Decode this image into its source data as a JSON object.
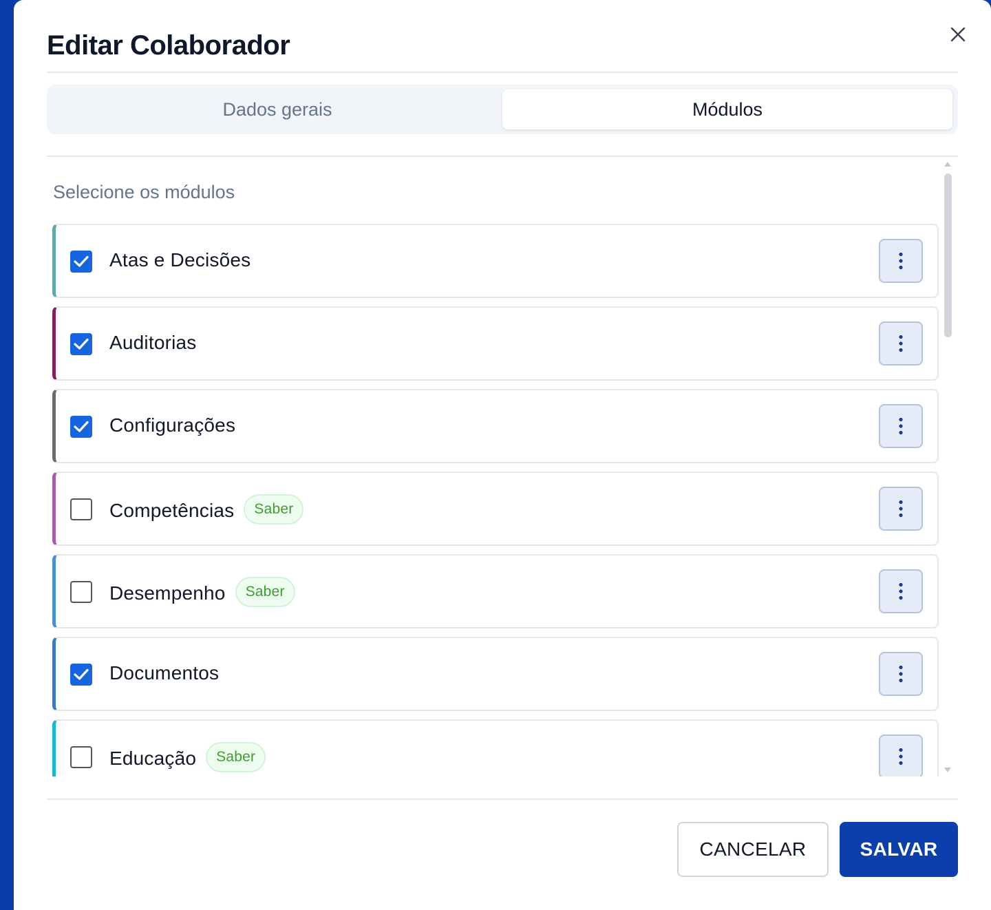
{
  "dialog": {
    "title": "Editar Colaborador",
    "close_icon": "close-icon"
  },
  "tabs": [
    {
      "label": "Dados gerais",
      "active": false
    },
    {
      "label": "Módulos",
      "active": true
    }
  ],
  "modules_section": {
    "label": "Selecione os módulos",
    "items": [
      {
        "name": "Atas e Decisões",
        "checked": true,
        "badge": "",
        "accent": "#5fa8a8"
      },
      {
        "name": "Auditorias",
        "checked": true,
        "badge": "",
        "accent": "#8a1c5c"
      },
      {
        "name": "Configurações",
        "checked": true,
        "badge": "",
        "accent": "#6b6b6b"
      },
      {
        "name": "Competências",
        "checked": false,
        "badge": "Saber",
        "accent": "#a45ba8"
      },
      {
        "name": "Desempenho",
        "checked": false,
        "badge": "Saber",
        "accent": "#4a8fd6"
      },
      {
        "name": "Documentos",
        "checked": true,
        "badge": "",
        "accent": "#3f78c8"
      },
      {
        "name": "Educação",
        "checked": false,
        "badge": "Saber",
        "accent": "#18b9d0"
      }
    ]
  },
  "footer": {
    "cancel_label": "CANCELAR",
    "save_label": "SALVAR"
  },
  "colors": {
    "primary": "#0b3fae",
    "checkbox_checked": "#1565e0",
    "badge_text": "#3f9d2a"
  }
}
